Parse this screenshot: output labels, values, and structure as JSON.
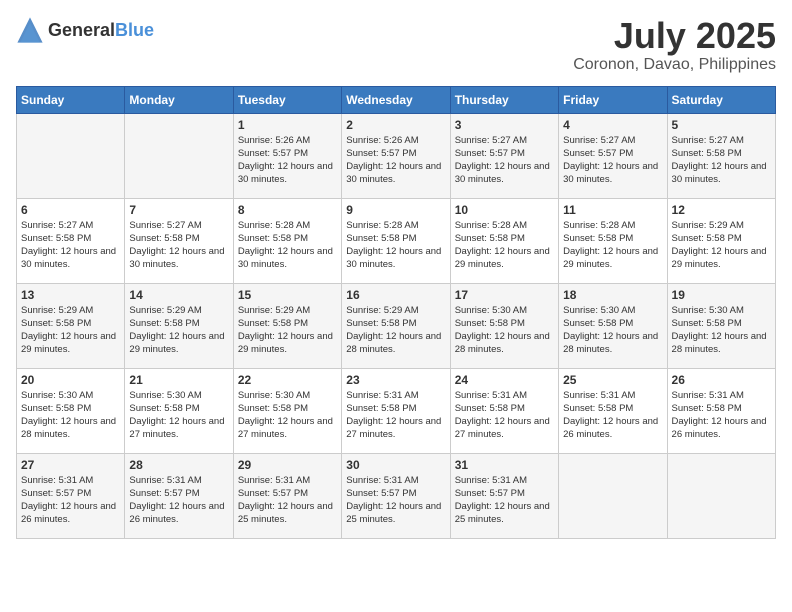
{
  "header": {
    "logo_general": "General",
    "logo_blue": "Blue",
    "month_year": "July 2025",
    "location": "Coronon, Davao, Philippines"
  },
  "days_of_week": [
    "Sunday",
    "Monday",
    "Tuesday",
    "Wednesday",
    "Thursday",
    "Friday",
    "Saturday"
  ],
  "weeks": [
    [
      {
        "day": "",
        "content": ""
      },
      {
        "day": "",
        "content": ""
      },
      {
        "day": "1",
        "content": "Sunrise: 5:26 AM\nSunset: 5:57 PM\nDaylight: 12 hours and 30 minutes."
      },
      {
        "day": "2",
        "content": "Sunrise: 5:26 AM\nSunset: 5:57 PM\nDaylight: 12 hours and 30 minutes."
      },
      {
        "day": "3",
        "content": "Sunrise: 5:27 AM\nSunset: 5:57 PM\nDaylight: 12 hours and 30 minutes."
      },
      {
        "day": "4",
        "content": "Sunrise: 5:27 AM\nSunset: 5:57 PM\nDaylight: 12 hours and 30 minutes."
      },
      {
        "day": "5",
        "content": "Sunrise: 5:27 AM\nSunset: 5:58 PM\nDaylight: 12 hours and 30 minutes."
      }
    ],
    [
      {
        "day": "6",
        "content": "Sunrise: 5:27 AM\nSunset: 5:58 PM\nDaylight: 12 hours and 30 minutes."
      },
      {
        "day": "7",
        "content": "Sunrise: 5:27 AM\nSunset: 5:58 PM\nDaylight: 12 hours and 30 minutes."
      },
      {
        "day": "8",
        "content": "Sunrise: 5:28 AM\nSunset: 5:58 PM\nDaylight: 12 hours and 30 minutes."
      },
      {
        "day": "9",
        "content": "Sunrise: 5:28 AM\nSunset: 5:58 PM\nDaylight: 12 hours and 30 minutes."
      },
      {
        "day": "10",
        "content": "Sunrise: 5:28 AM\nSunset: 5:58 PM\nDaylight: 12 hours and 29 minutes."
      },
      {
        "day": "11",
        "content": "Sunrise: 5:28 AM\nSunset: 5:58 PM\nDaylight: 12 hours and 29 minutes."
      },
      {
        "day": "12",
        "content": "Sunrise: 5:29 AM\nSunset: 5:58 PM\nDaylight: 12 hours and 29 minutes."
      }
    ],
    [
      {
        "day": "13",
        "content": "Sunrise: 5:29 AM\nSunset: 5:58 PM\nDaylight: 12 hours and 29 minutes."
      },
      {
        "day": "14",
        "content": "Sunrise: 5:29 AM\nSunset: 5:58 PM\nDaylight: 12 hours and 29 minutes."
      },
      {
        "day": "15",
        "content": "Sunrise: 5:29 AM\nSunset: 5:58 PM\nDaylight: 12 hours and 29 minutes."
      },
      {
        "day": "16",
        "content": "Sunrise: 5:29 AM\nSunset: 5:58 PM\nDaylight: 12 hours and 28 minutes."
      },
      {
        "day": "17",
        "content": "Sunrise: 5:30 AM\nSunset: 5:58 PM\nDaylight: 12 hours and 28 minutes."
      },
      {
        "day": "18",
        "content": "Sunrise: 5:30 AM\nSunset: 5:58 PM\nDaylight: 12 hours and 28 minutes."
      },
      {
        "day": "19",
        "content": "Sunrise: 5:30 AM\nSunset: 5:58 PM\nDaylight: 12 hours and 28 minutes."
      }
    ],
    [
      {
        "day": "20",
        "content": "Sunrise: 5:30 AM\nSunset: 5:58 PM\nDaylight: 12 hours and 28 minutes."
      },
      {
        "day": "21",
        "content": "Sunrise: 5:30 AM\nSunset: 5:58 PM\nDaylight: 12 hours and 27 minutes."
      },
      {
        "day": "22",
        "content": "Sunrise: 5:30 AM\nSunset: 5:58 PM\nDaylight: 12 hours and 27 minutes."
      },
      {
        "day": "23",
        "content": "Sunrise: 5:31 AM\nSunset: 5:58 PM\nDaylight: 12 hours and 27 minutes."
      },
      {
        "day": "24",
        "content": "Sunrise: 5:31 AM\nSunset: 5:58 PM\nDaylight: 12 hours and 27 minutes."
      },
      {
        "day": "25",
        "content": "Sunrise: 5:31 AM\nSunset: 5:58 PM\nDaylight: 12 hours and 26 minutes."
      },
      {
        "day": "26",
        "content": "Sunrise: 5:31 AM\nSunset: 5:58 PM\nDaylight: 12 hours and 26 minutes."
      }
    ],
    [
      {
        "day": "27",
        "content": "Sunrise: 5:31 AM\nSunset: 5:57 PM\nDaylight: 12 hours and 26 minutes."
      },
      {
        "day": "28",
        "content": "Sunrise: 5:31 AM\nSunset: 5:57 PM\nDaylight: 12 hours and 26 minutes."
      },
      {
        "day": "29",
        "content": "Sunrise: 5:31 AM\nSunset: 5:57 PM\nDaylight: 12 hours and 25 minutes."
      },
      {
        "day": "30",
        "content": "Sunrise: 5:31 AM\nSunset: 5:57 PM\nDaylight: 12 hours and 25 minutes."
      },
      {
        "day": "31",
        "content": "Sunrise: 5:31 AM\nSunset: 5:57 PM\nDaylight: 12 hours and 25 minutes."
      },
      {
        "day": "",
        "content": ""
      },
      {
        "day": "",
        "content": ""
      }
    ]
  ]
}
